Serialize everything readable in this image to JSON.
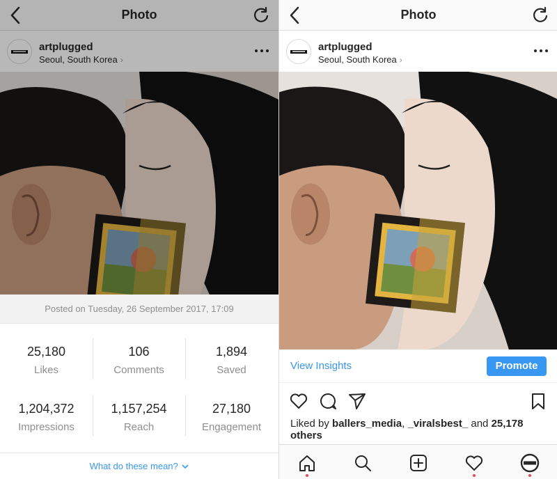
{
  "left_panel": {
    "nav": {
      "title": "Photo",
      "back_icon": "chevron-left-icon",
      "refresh_icon": "refresh-icon"
    },
    "post_header": {
      "username": "artplugged",
      "location": "Seoul, South Korea"
    },
    "posted_on": "Posted on Tuesday, 26 September 2017, 17:09",
    "stats": [
      {
        "value": "25,180",
        "label": "Likes"
      },
      {
        "value": "106",
        "label": "Comments"
      },
      {
        "value": "1,894",
        "label": "Saved"
      },
      {
        "value": "1,204,372",
        "label": "Impressions"
      },
      {
        "value": "1,157,254",
        "label": "Reach"
      },
      {
        "value": "27,180",
        "label": "Engagement"
      }
    ],
    "help_link": "What do these mean?"
  },
  "right_panel": {
    "nav": {
      "title": "Photo",
      "back_icon": "chevron-left-icon",
      "refresh_icon": "refresh-icon"
    },
    "post_header": {
      "username": "artplugged",
      "location": "Seoul, South Korea"
    },
    "view_insights": "View Insights",
    "promote": "Promote",
    "liked_by": {
      "prefix": "Liked by ",
      "user1": "ballers_media",
      "sep": ", ",
      "user2": "_viralsbest_",
      "and": " and ",
      "count": "25,178",
      "suffix": "others"
    },
    "tabbar_icons": [
      "home-icon",
      "search-icon",
      "add-post-icon",
      "activity-heart-icon",
      "profile-icon"
    ]
  },
  "colors": {
    "accent": "#3897f0",
    "notification": "#ed4956",
    "text": "#262626",
    "muted": "#8e8e8e"
  }
}
